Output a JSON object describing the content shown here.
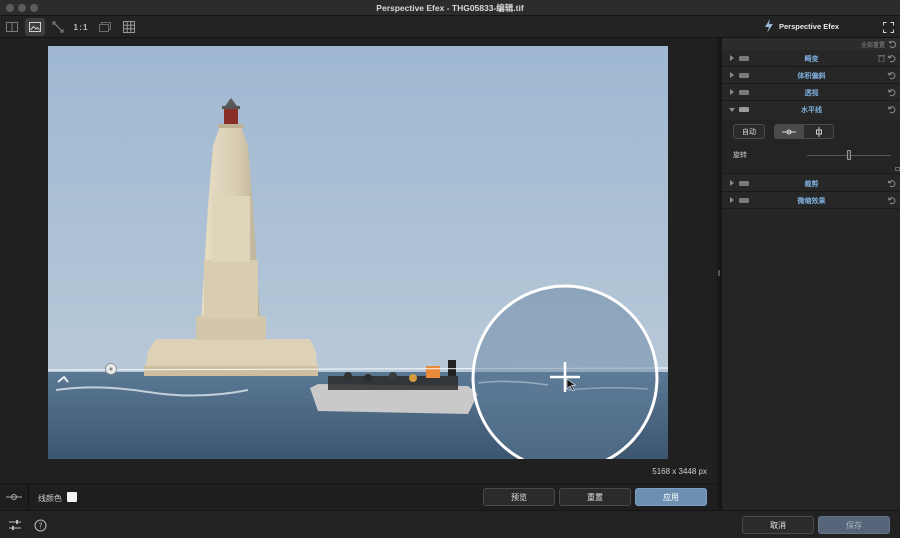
{
  "window": {
    "title": "Perspective Efex - THG05833-编辑.tif"
  },
  "toolbar": {
    "zoom_1to1_label": "1:1",
    "brand_name": "Perspective Efex"
  },
  "canvas": {
    "image_dimensions": "5168 x 3448 px"
  },
  "subbar": {
    "line_color_label": "线颜色",
    "line_color": "#f2f2f2",
    "preview_label": "预览",
    "reset_label": "重置",
    "apply_label": "应用"
  },
  "footer": {
    "cancel_label": "取消",
    "save_label": "保存"
  },
  "panel": {
    "reset_all_label": "全部重置",
    "sections": [
      {
        "label": "畸变",
        "expanded": false
      },
      {
        "label": "体积偏斜",
        "expanded": false
      },
      {
        "label": "透视",
        "expanded": false
      },
      {
        "label": "水平线",
        "expanded": true
      },
      {
        "label": "裁剪",
        "expanded": false
      },
      {
        "label": "微缩效果",
        "expanded": false
      }
    ],
    "horizon": {
      "auto_label": "自动",
      "rotation_label": "旋转",
      "rotation_value": 0.5
    }
  },
  "colors": {
    "accent": "#6d8fb2",
    "section_label": "#7fb0de",
    "background": "#1b1b1b"
  }
}
